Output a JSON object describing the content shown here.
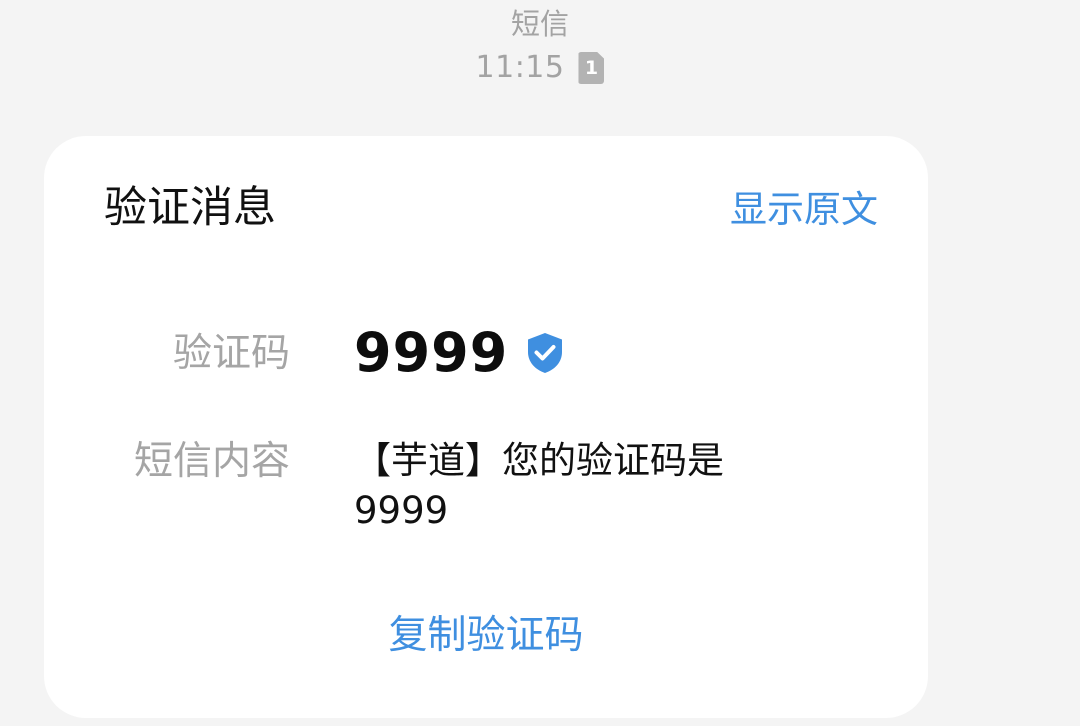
{
  "header": {
    "sender": "短信",
    "time": "11:15",
    "sim_badge": "1"
  },
  "card": {
    "title": "验证消息",
    "show_original_label": "显示原文",
    "code_label": "验证码",
    "code_value": "9999",
    "content_label": "短信内容",
    "content_lines": [
      "【芋道】您的验证码是",
      "9999"
    ],
    "copy_button_label": "复制验证码"
  },
  "icons": {
    "verified": "shield-check-icon",
    "sim": "sim-card-icon"
  },
  "colors": {
    "accent": "#3f8fe0",
    "badge": "#b3b3b3",
    "background": "#f4f4f4",
    "card": "#ffffff"
  }
}
